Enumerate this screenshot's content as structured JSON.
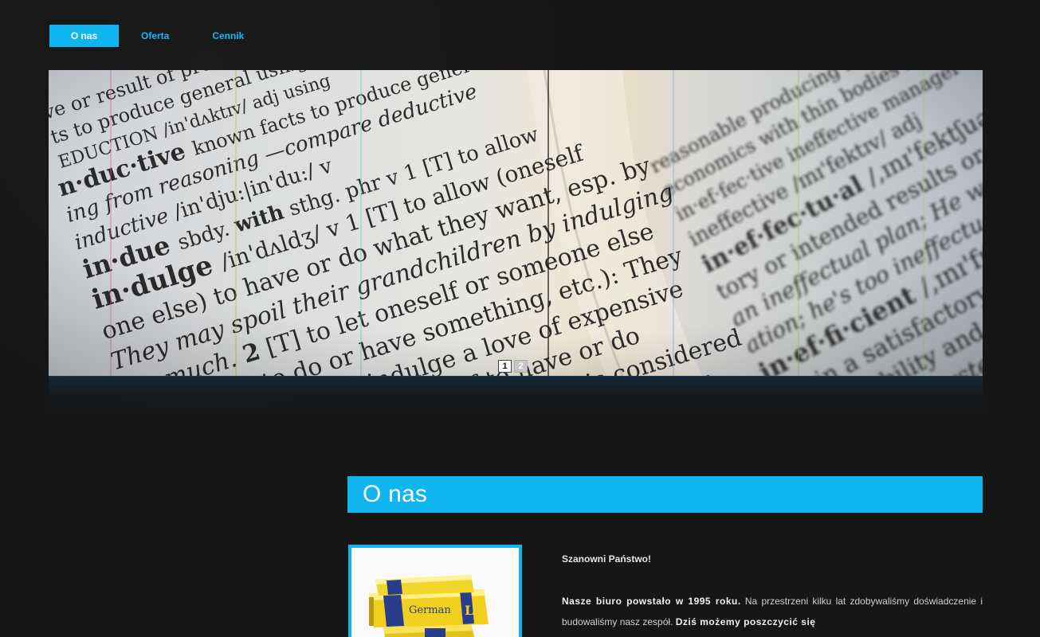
{
  "nav": {
    "items": [
      {
        "label": "O nas",
        "active": true
      },
      {
        "label": "Oferta",
        "active": false
      },
      {
        "label": "Cennik",
        "active": false
      }
    ]
  },
  "slider": {
    "pages": [
      "1",
      "2"
    ],
    "active_page": "1",
    "image_icon": "dictionary-photo"
  },
  "section": {
    "title": "O nas"
  },
  "content": {
    "image_icon": "language-books-stack",
    "greeting": "Szanowni Państwo!",
    "para_bold_1": "Nasze biuro powstało w 1995 roku.",
    "para_text_1": " Na przestrzeni kilku lat zdobywaliśmy doświadczenie i budowaliśmy nasz zespół. ",
    "para_bold_2": "Dziś możemy poszczycić się"
  },
  "colors": {
    "background": "#161616",
    "accent": "#10b4ee",
    "nav_link": "#16b8ff",
    "text": "#cfcfcf"
  }
}
